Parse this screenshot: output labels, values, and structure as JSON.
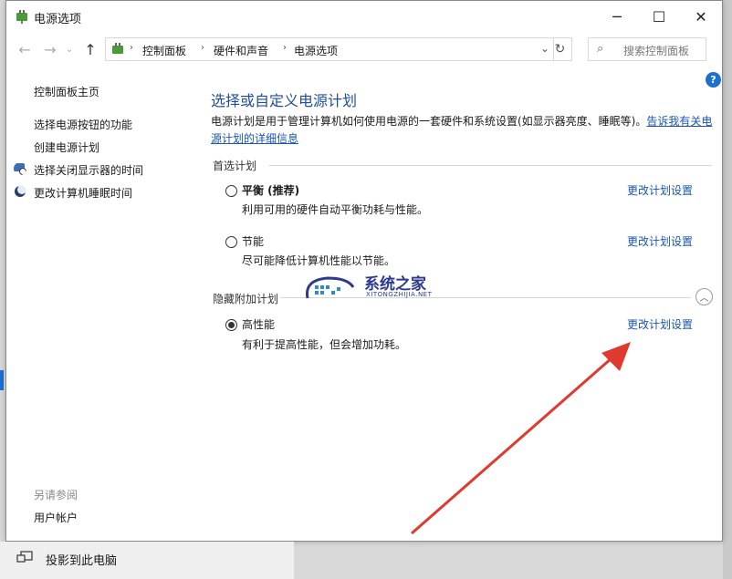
{
  "window": {
    "title": "电源选项",
    "min_icon": "─",
    "max_icon": "☐",
    "close_icon": "✕"
  },
  "nav": {
    "back_icon": "←",
    "forward_icon": "→",
    "recent_icon": "⌄",
    "up_icon": "↑",
    "breadcrumbs": [
      "控制面板",
      "硬件和声音",
      "电源选项"
    ],
    "separator": "›",
    "dropdown_icon": "⌄",
    "refresh_icon": "↻",
    "search_placeholder": "搜索控制面板",
    "search_icon": "⌕"
  },
  "help": "?",
  "sidebar": {
    "home": "控制面板主页",
    "items": [
      {
        "label": "选择电源按钮的功能",
        "icon": ""
      },
      {
        "label": "创建电源计划",
        "icon": ""
      },
      {
        "label": "选择关闭显示器的时间",
        "icon": "monitor-clock-icon"
      },
      {
        "label": "更改计算机睡眠时间",
        "icon": "moon-icon"
      }
    ],
    "see_also_title": "另请参阅",
    "see_also_items": [
      "用户帐户"
    ]
  },
  "main": {
    "title": "选择或自定义电源计划",
    "desc_text": "电源计划是用于管理计算机如何使用电源的一套硬件和系统设置(如显示器亮度、睡眠等)。",
    "desc_link_1": "告诉我有关电",
    "desc_link_2": "源计划的详细信息",
    "preferred_label": "首选计划",
    "hidden_label": "隐藏附加计划",
    "collapse_icon": "︿",
    "plans": [
      {
        "name": "平衡 (推荐)",
        "desc": "利用可用的硬件自动平衡功耗与性能。",
        "selected": false,
        "change": "更改计划设置"
      },
      {
        "name": "节能",
        "desc": "尽可能降低计算机性能以节能。",
        "selected": false,
        "change": "更改计划设置"
      },
      {
        "name": "高性能",
        "desc": "有利于提高性能，但会增加功耗。",
        "selected": true,
        "change": "更改计划设置"
      }
    ]
  },
  "watermark": {
    "title": "系统之家",
    "subtitle": "XITONGZHIJIA.NET"
  },
  "taskbar": {
    "label": "投影到此电脑"
  },
  "colors": {
    "link": "#1a55b0",
    "title": "#1f4e9c",
    "arrow": "#e03a2f"
  }
}
